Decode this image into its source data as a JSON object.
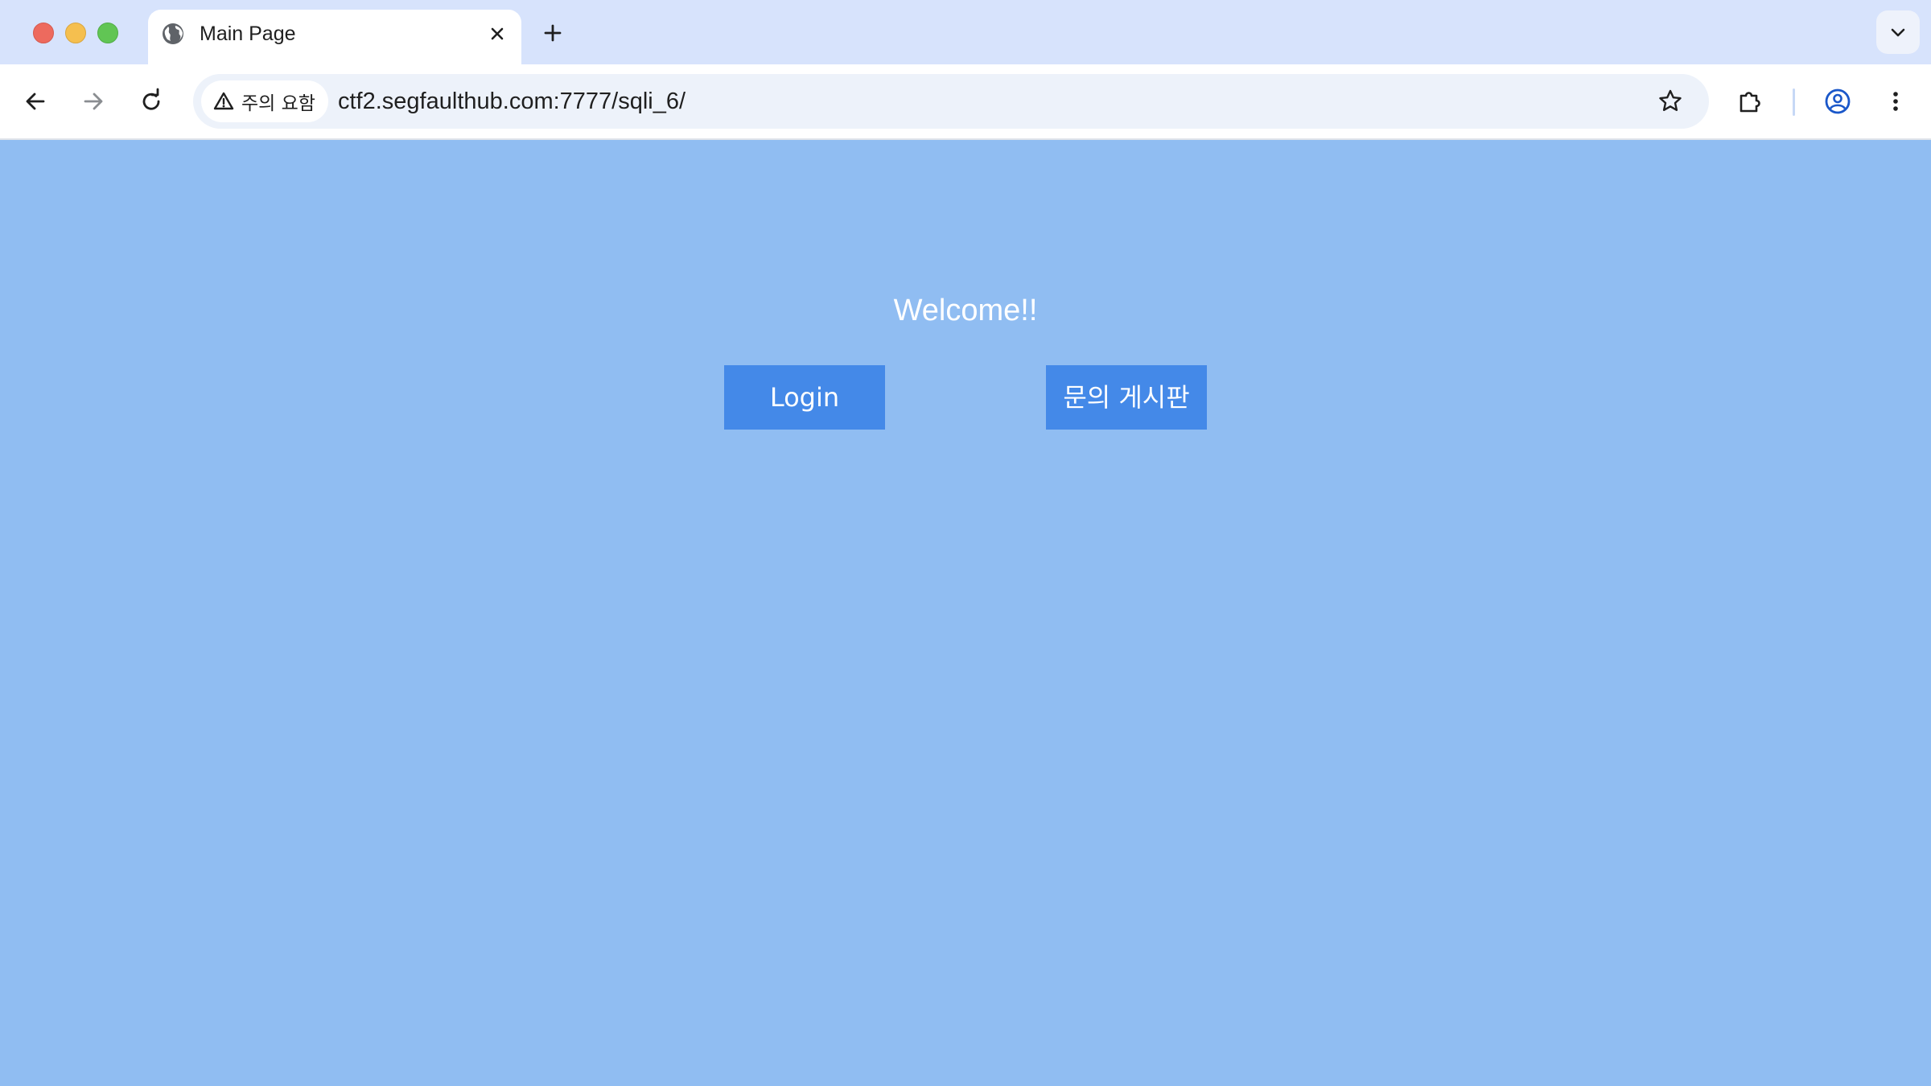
{
  "browser": {
    "tab": {
      "title": "Main Page",
      "favicon": "globe-icon"
    },
    "omnibox": {
      "security_chip_label": "주의 요함",
      "url": "ctf2.segfaulthub.com:7777/sqli_6/"
    },
    "colors": {
      "tabstrip": "#d7e3fc",
      "toolbar": "#ffffff",
      "omnibox": "#edf2fa"
    }
  },
  "page": {
    "welcome_text": "Welcome!!",
    "buttons": {
      "login_label": "Login",
      "board_label": "문의 게시판"
    },
    "colors": {
      "background": "#90bdf2",
      "button": "#4489e8",
      "text": "#ffffff"
    }
  }
}
